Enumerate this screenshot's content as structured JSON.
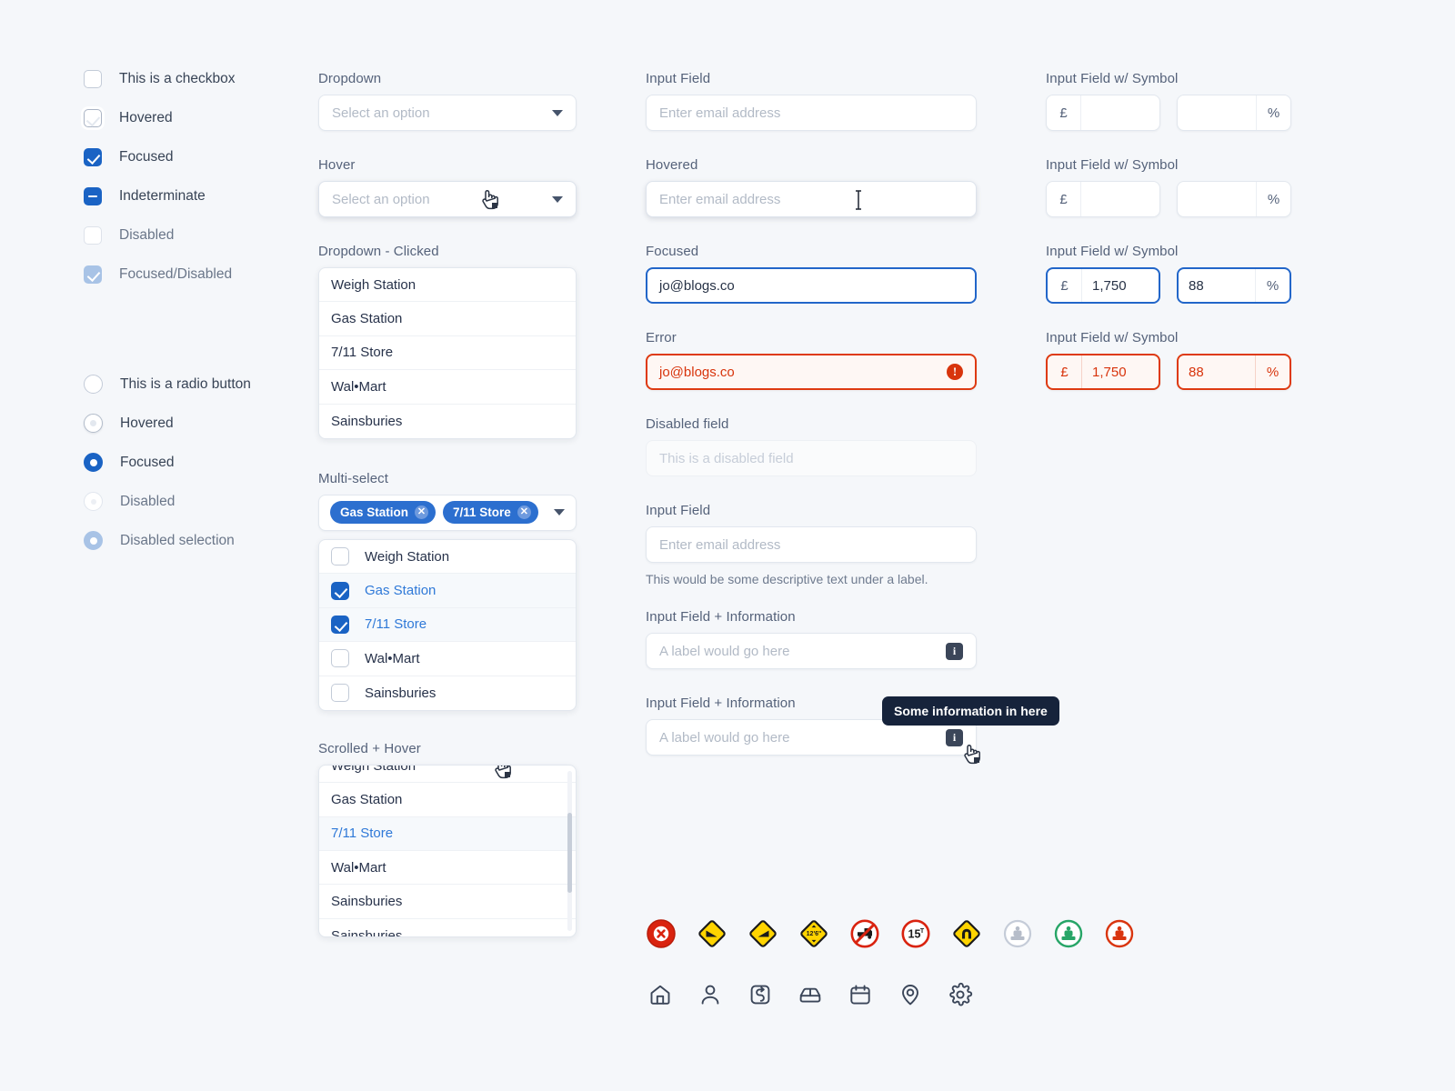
{
  "checkboxes": {
    "items": [
      {
        "label": "This is a checkbox",
        "state": "default"
      },
      {
        "label": "Hovered",
        "state": "hovered"
      },
      {
        "label": "Focused",
        "state": "checked"
      },
      {
        "label": "Indeterminate",
        "state": "indeterminate"
      },
      {
        "label": "Disabled",
        "state": "disabled"
      },
      {
        "label": "Focused/Disabled",
        "state": "checked-disabled"
      }
    ]
  },
  "radios": {
    "items": [
      {
        "label": "This is a radio button",
        "state": "default"
      },
      {
        "label": "Hovered",
        "state": "hovered"
      },
      {
        "label": "Focused",
        "state": "selected"
      },
      {
        "label": "Disabled",
        "state": "disabled"
      },
      {
        "label": "Disabled selection",
        "state": "selected-disabled"
      }
    ]
  },
  "dropdowns": {
    "basic": {
      "label": "Dropdown",
      "placeholder": "Select an option"
    },
    "hover": {
      "label": "Hover",
      "placeholder": "Select an option"
    },
    "clicked": {
      "label": "Dropdown - Clicked",
      "options": [
        "Weigh Station",
        "Gas Station",
        "7/11 Store",
        "Wal•Mart",
        "Sainsburies"
      ]
    },
    "multiselect": {
      "label": "Multi-select",
      "chips": [
        "Gas Station",
        "7/11 Store"
      ],
      "options": [
        {
          "label": "Weigh Station",
          "checked": false
        },
        {
          "label": "Gas Station",
          "checked": true
        },
        {
          "label": "7/11 Store",
          "checked": true
        },
        {
          "label": "Wal•Mart",
          "checked": false
        },
        {
          "label": "Sainsburies",
          "checked": false
        }
      ]
    },
    "scrolled": {
      "label": "Scrolled + Hover",
      "options": [
        "Weigh Station",
        "Gas Station",
        "7/11 Store",
        "Wal•Mart",
        "Sainsburies",
        "Sainsburies"
      ],
      "hovered_option": "7/11 Store"
    }
  },
  "inputs": {
    "basic": {
      "label": "Input Field",
      "placeholder": "Enter email address",
      "value": ""
    },
    "hovered": {
      "label": "Hovered",
      "placeholder": "Enter email address",
      "value": ""
    },
    "focused": {
      "label": "Focused",
      "placeholder": "Enter email address",
      "value": "jo@blogs.co"
    },
    "error": {
      "label": "Error",
      "placeholder": "Enter email address",
      "value": "jo@blogs.co"
    },
    "disabled": {
      "label": "Disabled field",
      "placeholder": "This is a disabled field",
      "value": ""
    },
    "helper": {
      "label": "Input Field",
      "placeholder": "Enter email address",
      "value": "",
      "description": "This would be some descriptive text under a label."
    },
    "info1": {
      "label": "Input Field  +  Information",
      "placeholder": "A label would go here",
      "value": ""
    },
    "info2": {
      "label": "Input Field  +  Information",
      "placeholder": "A label would go here",
      "value": "",
      "tooltip": "Some information in here"
    }
  },
  "symbol_inputs": {
    "rows": [
      {
        "label": "Input Field w/ Symbol",
        "state": "default",
        "left": {
          "symbol": "£",
          "value": ""
        },
        "right": {
          "symbol": "%",
          "value": ""
        }
      },
      {
        "label": "Input Field w/ Symbol",
        "state": "default",
        "left": {
          "symbol": "£",
          "value": ""
        },
        "right": {
          "symbol": "%",
          "value": ""
        }
      },
      {
        "label": "Input Field w/ Symbol",
        "state": "focused",
        "left": {
          "symbol": "£",
          "value": "1,750"
        },
        "right": {
          "symbol": "%",
          "value": "88"
        }
      },
      {
        "label": "Input Field w/ Symbol",
        "state": "error",
        "left": {
          "symbol": "£",
          "value": "1,750"
        },
        "right": {
          "symbol": "%",
          "value": "88"
        }
      }
    ]
  },
  "icons": {
    "signs": [
      "no-entry-sign-icon",
      "steep-hill-sign-icon",
      "steep-descent-sign-icon",
      "low-clearance-12-6-sign-icon",
      "no-trucks-sign-icon",
      "weight-limit-15t-sign-icon",
      "tunnel-sign-icon",
      "weigh-station-grey-icon",
      "weigh-station-green-icon",
      "weigh-station-red-icon"
    ],
    "signs_labels": {
      "clearance": "12’6”",
      "weight": "15",
      "weight_unit": "T"
    },
    "ui": [
      "home-icon",
      "user-icon",
      "route-icon",
      "truck-icon",
      "calendar-icon",
      "location-pin-icon",
      "gear-icon"
    ]
  },
  "colors": {
    "accent": "#1a63c4",
    "accent_link": "#2f79d8",
    "error": "#de3a11",
    "chip": "#2c6fcf",
    "bg": "#f5f7fa",
    "sign_yellow": "#ffd400",
    "sign_red": "#d9230f",
    "sign_green": "#27a567",
    "tooltip_bg": "#16233b"
  }
}
